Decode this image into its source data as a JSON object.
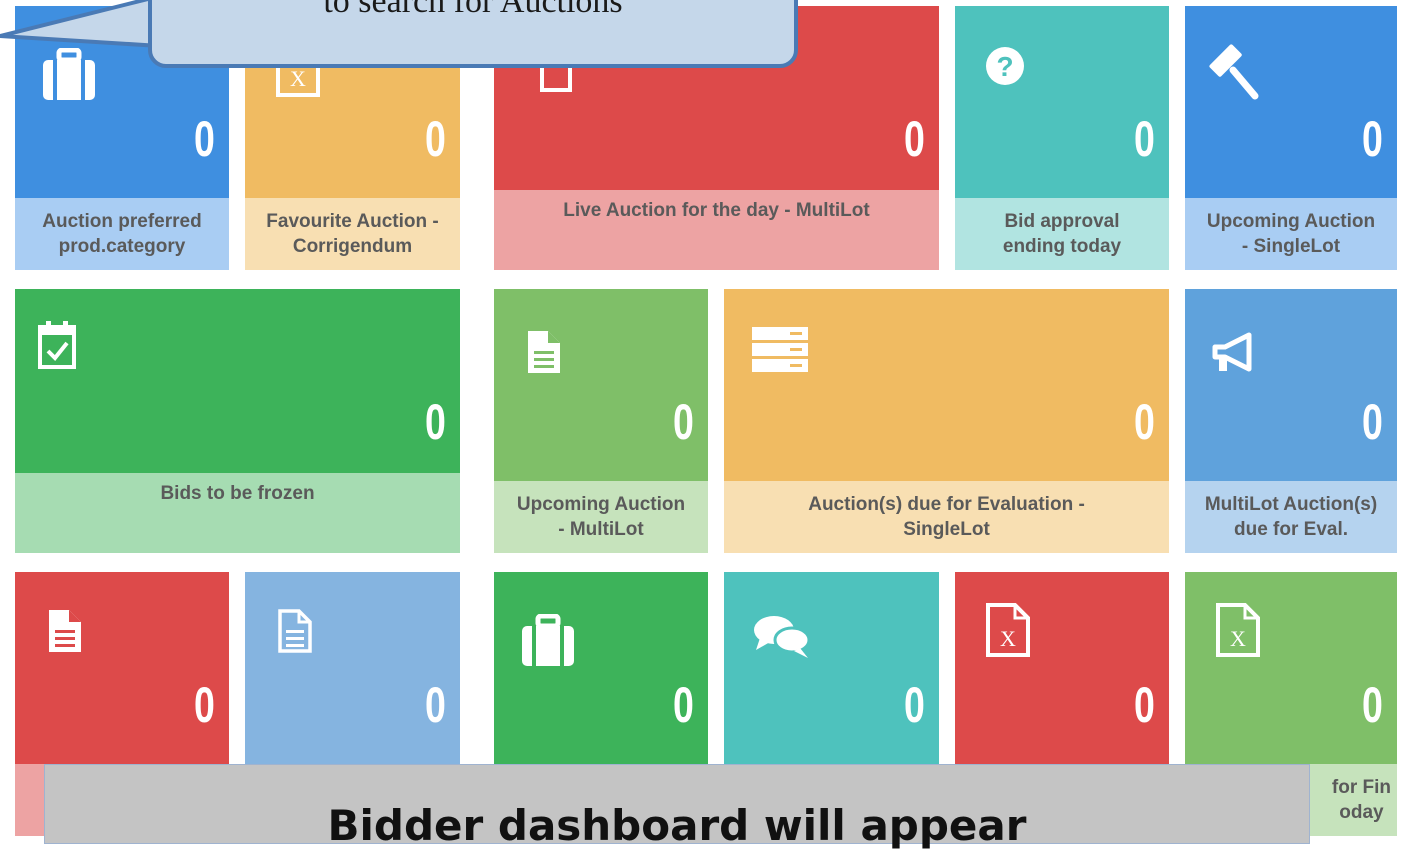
{
  "callout": {
    "text": "to search for Auctions"
  },
  "overlay": {
    "text": "Bidder dashboard will appear"
  },
  "colors": {
    "blue": "#3f8fe0",
    "orange": "#f0bb62",
    "red": "#dd4a4a",
    "teal": "#4ec2bd",
    "green": "#3db35a",
    "light_green": "#7fbf68",
    "steel_blue": "#5fa2dc",
    "pale_blue": "#85b4e0",
    "callout_fill": "#c5d7ea",
    "callout_border": "#4a7ab5",
    "overlay_fill": "#c4c4c4"
  },
  "tiles": [
    {
      "label": "Auction preferred\nprod.category",
      "count": "0",
      "icon": "briefcase-icon",
      "color": "blue"
    },
    {
      "label": "Favourite Auction -\nCorrigendum",
      "count": "0",
      "icon": "excel-file-icon",
      "color": "orange"
    },
    {
      "label": "Live Auction for the day - MultiLot",
      "count": "0",
      "icon": "copy-icon",
      "color": "red"
    },
    {
      "label": "Bid approval\nending today",
      "count": "0",
      "icon": "question-circle-icon",
      "color": "teal"
    },
    {
      "label": "Upcoming Auction\n- SingleLot",
      "count": "0",
      "icon": "gavel-icon",
      "color": "blue"
    },
    {
      "label": "Bids to be frozen",
      "count": "0",
      "icon": "calendar-check-icon",
      "color": "green"
    },
    {
      "label": "Upcoming Auction\n- MultiLot",
      "count": "0",
      "icon": "document-icon",
      "color": "light_green"
    },
    {
      "label": "Auction(s) due for Evaluation -\nSingleLot",
      "count": "0",
      "icon": "server-icon",
      "color": "orange"
    },
    {
      "label": "MultiLot Auction(s)\ndue for Eval.",
      "count": "0",
      "icon": "megaphone-icon",
      "color": "steel_blue"
    },
    {
      "label": "",
      "count": "0",
      "icon": "document-icon",
      "color": "red"
    },
    {
      "label": "",
      "count": "0",
      "icon": "document-outline-icon",
      "color": "pale_blue"
    },
    {
      "label": "",
      "count": "0",
      "icon": "briefcase-icon",
      "color": "green"
    },
    {
      "label": "",
      "count": "0",
      "icon": "chat-bubbles-icon",
      "color": "teal"
    },
    {
      "label": "",
      "count": "0",
      "icon": "excel-file-icon",
      "color": "red"
    },
    {
      "label": "for Fin\noday",
      "count": "0",
      "icon": "excel-file-icon",
      "color": "light_green"
    }
  ]
}
